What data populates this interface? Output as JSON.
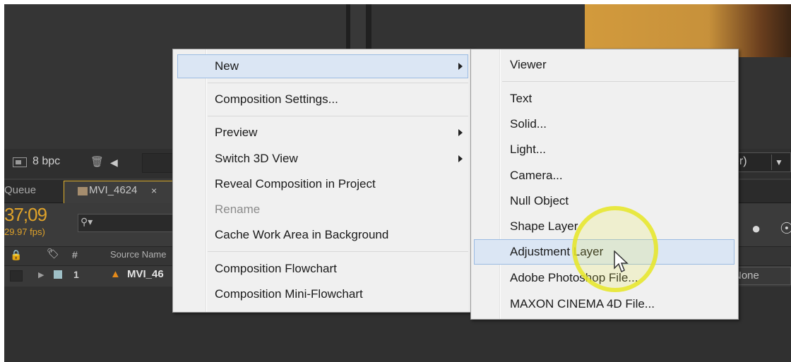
{
  "viewer": {
    "bpc_label": "8 bpc",
    "view_dropdown_text": "er)",
    "view_dropdown_arrow": "▼"
  },
  "tabs": {
    "queue_label": "Queue",
    "comp_tab_label": "MVI_4624",
    "comp_tab_close": "×"
  },
  "timeline": {
    "timecode": "37;09",
    "fps": "29.97 fps)",
    "search_placeholder": "",
    "columns": {
      "number": "#",
      "source_name": "Source Name"
    },
    "layers": [
      {
        "number": "1",
        "name": "MVI_46",
        "mode": "None"
      }
    ]
  },
  "context_menu": {
    "items": [
      {
        "label": "New",
        "has_submenu": true,
        "highlighted": true,
        "disabled": false
      },
      {
        "label": "Composition Settings...",
        "has_submenu": false,
        "disabled": false
      },
      {
        "label": "Preview",
        "has_submenu": true,
        "disabled": false
      },
      {
        "label": "Switch 3D View",
        "has_submenu": true,
        "disabled": false
      },
      {
        "label": "Reveal Composition in Project",
        "has_submenu": false,
        "disabled": false
      },
      {
        "label": "Rename",
        "has_submenu": false,
        "disabled": true
      },
      {
        "label": "Cache Work Area in Background",
        "has_submenu": false,
        "disabled": false
      },
      {
        "label": "Composition Flowchart",
        "has_submenu": false,
        "disabled": false
      },
      {
        "label": "Composition Mini-Flowchart",
        "has_submenu": false,
        "disabled": false
      }
    ]
  },
  "submenu_new": {
    "items": [
      {
        "label": "Viewer"
      },
      {
        "label": "Text"
      },
      {
        "label": "Solid..."
      },
      {
        "label": "Light..."
      },
      {
        "label": "Camera..."
      },
      {
        "label": "Null Object"
      },
      {
        "label": "Shape Layer"
      },
      {
        "label": "Adjustment Layer",
        "highlighted": true
      },
      {
        "label": "Adobe Photoshop File..."
      },
      {
        "label": "MAXON CINEMA 4D File..."
      }
    ]
  },
  "colors": {
    "accent_orange": "#e0a32a",
    "menu_highlight": "#dbe6f4",
    "cursor_ring": "#e6e628"
  }
}
